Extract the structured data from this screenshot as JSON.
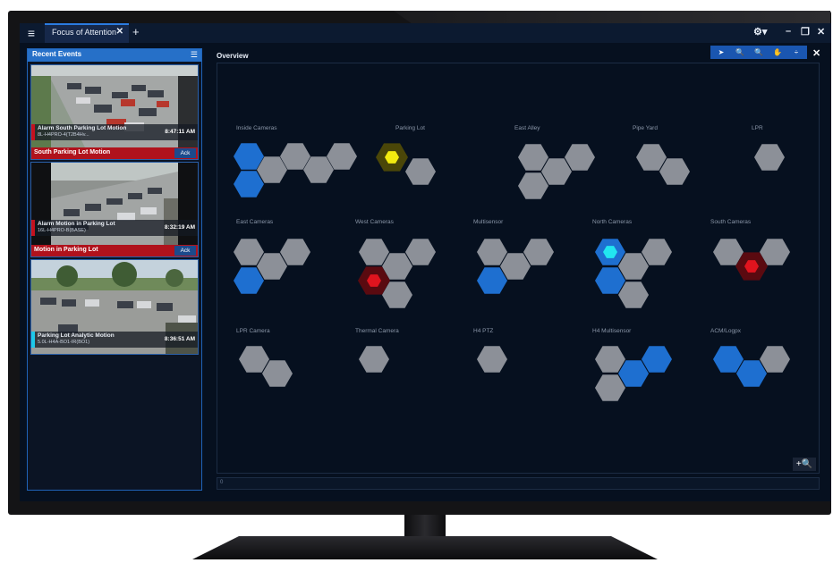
{
  "window": {
    "tab_label": "Focus of Attention",
    "close_glyph": "✕",
    "add_glyph": "+",
    "menu_glyph": "≡",
    "settings_glyph": "⚙▾",
    "minimize_glyph": "–",
    "restore_glyph": "❐",
    "window_close_glyph": "✕"
  },
  "recent_events": {
    "title": "Recent Events",
    "items": [
      {
        "name": "Alarm South Parking Lot Motion",
        "id": "8L-H4PRO-4(T2B4Hv...",
        "time": "8:47:11 AM",
        "bar_label": "South Parking Lot Motion",
        "ack": "Ack",
        "stripe": "#c4121e"
      },
      {
        "name": "Alarm Motion in Parking Lot",
        "id": "16L-H4PRO-B(BASE)",
        "time": "8:32:19 AM",
        "bar_label": "Motion in Parking Lot",
        "ack": "Ack",
        "stripe": "#c4121e"
      },
      {
        "name": "Parking Lot Analytic Motion",
        "id": "5.0L-H4A-BO1-IR(BO1)",
        "time": "8:36:51 AM",
        "stripe": "#1ec8e8"
      }
    ]
  },
  "overview": {
    "title": "Overview",
    "status_text": "0",
    "zoom_label": "+🔍",
    "toolbar": [
      "select",
      "zoom-in",
      "zoom-out",
      "pan",
      "fit"
    ],
    "toolbar_glyphs": [
      "➤",
      "🔍",
      "🔍",
      "✋",
      "÷"
    ],
    "close_glyph": "✕"
  },
  "groups": [
    {
      "label": "Inside Cameras"
    },
    {
      "label": "Parking Lot"
    },
    {
      "label": "East Alley"
    },
    {
      "label": "Pipe Yard"
    },
    {
      "label": "LPR"
    },
    {
      "label": "East Cameras"
    },
    {
      "label": "West Cameras"
    },
    {
      "label": "Multisensor"
    },
    {
      "label": "North Cameras"
    },
    {
      "label": "South Cameras"
    },
    {
      "label": "LPR Camera"
    },
    {
      "label": "Thermal Camera"
    },
    {
      "label": "H4 PTZ"
    },
    {
      "label": "H4 Multisensor"
    },
    {
      "label": "ACM/Logpx"
    }
  ],
  "colors": {
    "gray": "#8c9098",
    "blue": "#1e6fd0",
    "red": "#e0141e",
    "yellow": "#f2ea10",
    "cyan": "#22e6f0",
    "accent": "#2670c8"
  }
}
